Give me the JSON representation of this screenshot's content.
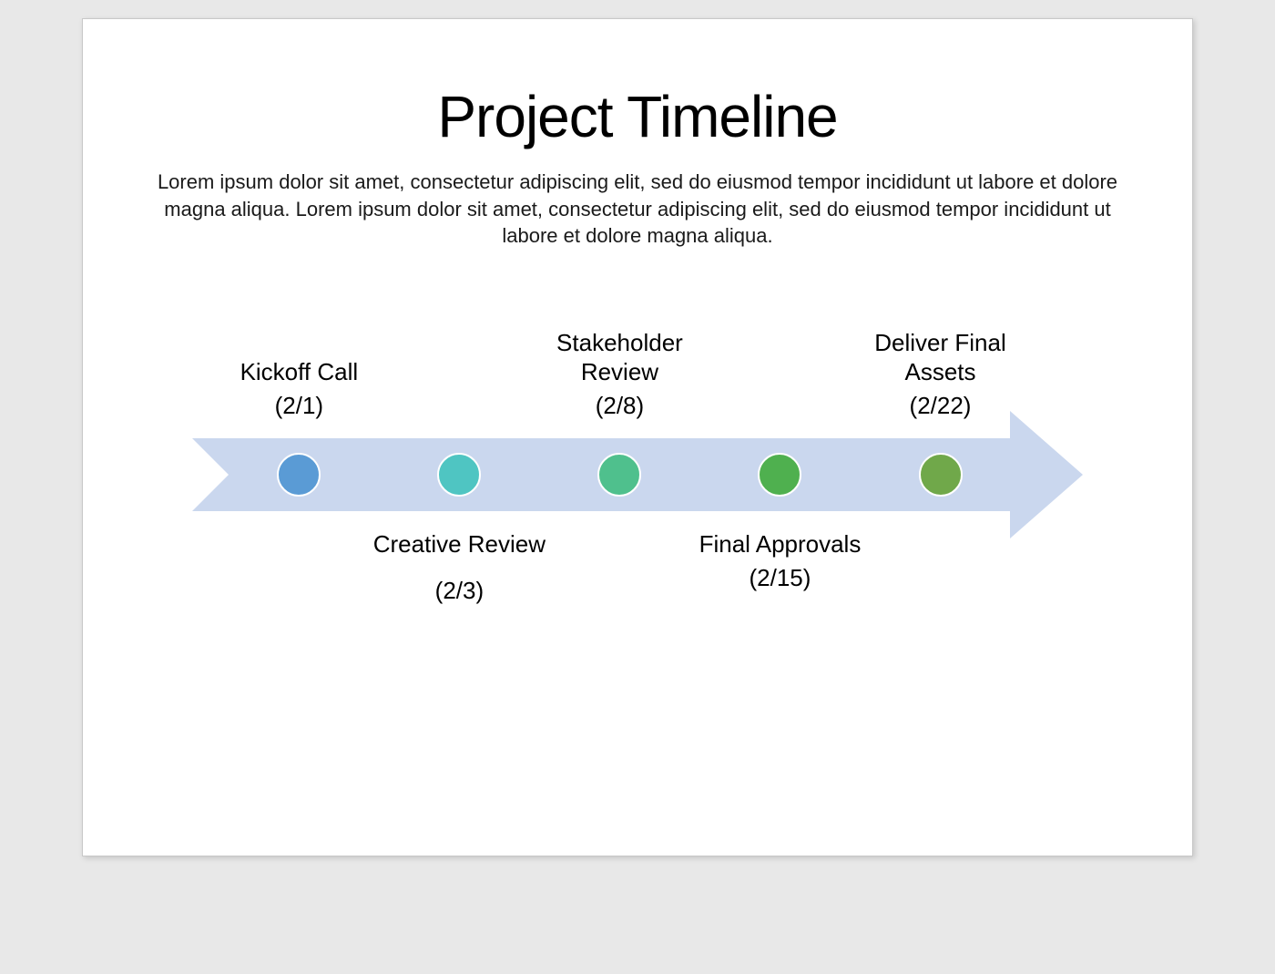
{
  "title": "Project Timeline",
  "subtitle": "Lorem ipsum dolor sit amet, consectetur adipiscing elit, sed do eiusmod tempor incididunt ut labore et dolore magna aliqua. Lorem ipsum dolor sit amet, consectetur adipiscing elit, sed do eiusmod tempor incididunt ut labore et dolore magna aliqua.",
  "arrow_color": "#cad7ee",
  "milestones": [
    {
      "label": "Kickoff Call",
      "date": "(2/1)",
      "color": "#5a9bd5",
      "position": "above",
      "x_pct": 12,
      "date_gap": false
    },
    {
      "label": "Creative Review",
      "date": "(2/3)",
      "color": "#4fc5c2",
      "position": "below",
      "x_pct": 30,
      "date_gap": true
    },
    {
      "label": "Stakeholder Review",
      "date": "(2/8)",
      "color": "#4fc08d",
      "position": "above",
      "x_pct": 48,
      "date_gap": false
    },
    {
      "label": "Final Approvals",
      "date": "(2/15)",
      "color": "#4fb04f",
      "position": "below",
      "x_pct": 66,
      "date_gap": false
    },
    {
      "label": "Deliver Final Assets",
      "date": "(2/22)",
      "color": "#70a84a",
      "position": "above",
      "x_pct": 84,
      "date_gap": false
    }
  ]
}
